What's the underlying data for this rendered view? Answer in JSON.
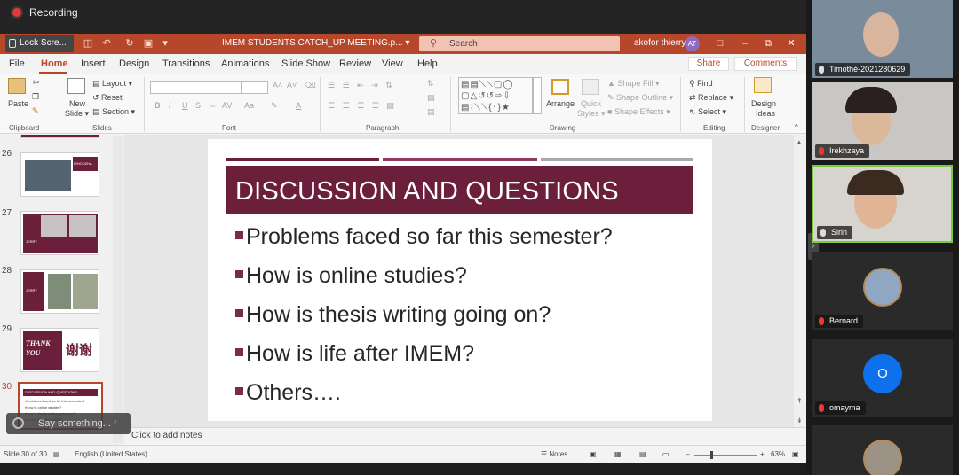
{
  "recording": {
    "label": "Recording"
  },
  "app": {
    "lock_screen": "Lock Scre...",
    "doc_title": "IMEM STUDENTS CATCH_UP MEETING.p... ▾",
    "search_placeholder": "Search",
    "user_name": "akofor thierry",
    "user_initials": "AT",
    "share_label": "Share",
    "comments_label": "Comments"
  },
  "tabs": [
    "File",
    "Home",
    "Insert",
    "Design",
    "Transitions",
    "Animations",
    "Slide Show",
    "Review",
    "View",
    "Help"
  ],
  "ribbon": {
    "clipboard": {
      "paste": "Paste",
      "group": "Clipboard"
    },
    "slides": {
      "new_slide_1": "New",
      "new_slide_2": "Slide ▾",
      "layout": "Layout ▾",
      "reset": "Reset",
      "section": "Section ▾",
      "group": "Slides"
    },
    "font": {
      "group": "Font",
      "bold": "B",
      "italic": "I",
      "underline": "U",
      "strike": "S",
      "spacing": "AV",
      "case": "Aa",
      "grow": "A˄",
      "shrink": "A˅"
    },
    "paragraph": {
      "group": "Paragraph"
    },
    "drawing": {
      "arrange": "Arrange",
      "quick_1": "Quick",
      "quick_2": "Styles ▾",
      "shape_fill": "Shape Fill ▾",
      "shape_outline": "Shape Outline ▾",
      "shape_effects": "Shape Effects ▾",
      "group": "Drawing"
    },
    "editing": {
      "find": "Find",
      "replace": "Replace ▾",
      "select": "Select ▾",
      "group": "Editing"
    },
    "designer": {
      "design_1": "Design",
      "design_2": "Ideas",
      "group": "Designer"
    }
  },
  "thumbnails": [
    {
      "num": "26",
      "label": "ISHODZHA"
    },
    {
      "num": "27",
      "label": "JERRY"
    },
    {
      "num": "28",
      "label": "JERRY"
    },
    {
      "num": "29",
      "label_1": "THANK",
      "label_2": "YOU",
      "label_3": "谢谢"
    },
    {
      "num": "30",
      "title": "DISCUSSION AND QUESTIONS",
      "lines": [
        "▪Problems faced so far this semester?",
        "▪How is online studies?",
        "▪How is thesis writing going on?",
        "▪How is life after IMEM?"
      ]
    }
  ],
  "slide": {
    "title": "DISCUSSION AND QUESTIONS",
    "bullets": [
      "Problems faced so far this semester?",
      "How is online studies?",
      "How is thesis writing going on?",
      "How is life after IMEM?",
      "Others…."
    ],
    "accent_colors": {
      "dark": "#6b1f3a",
      "mid": "#8e3a63",
      "light": "#a6a9ad"
    }
  },
  "notes_placeholder": "Click to add notes",
  "status": {
    "slide_info": "Slide 30 of 30",
    "language": "English (United States)",
    "notes": "Notes",
    "zoom": "63%"
  },
  "say_something": "Say something...",
  "participants": [
    {
      "name": "Timothé-2021280629",
      "muted": false
    },
    {
      "name": "Irekhzaya",
      "muted": true
    },
    {
      "name": "Sirin",
      "muted": false
    },
    {
      "name": "Bernard",
      "muted": true
    },
    {
      "name": "omayma",
      "muted": true,
      "initial": "O"
    }
  ]
}
